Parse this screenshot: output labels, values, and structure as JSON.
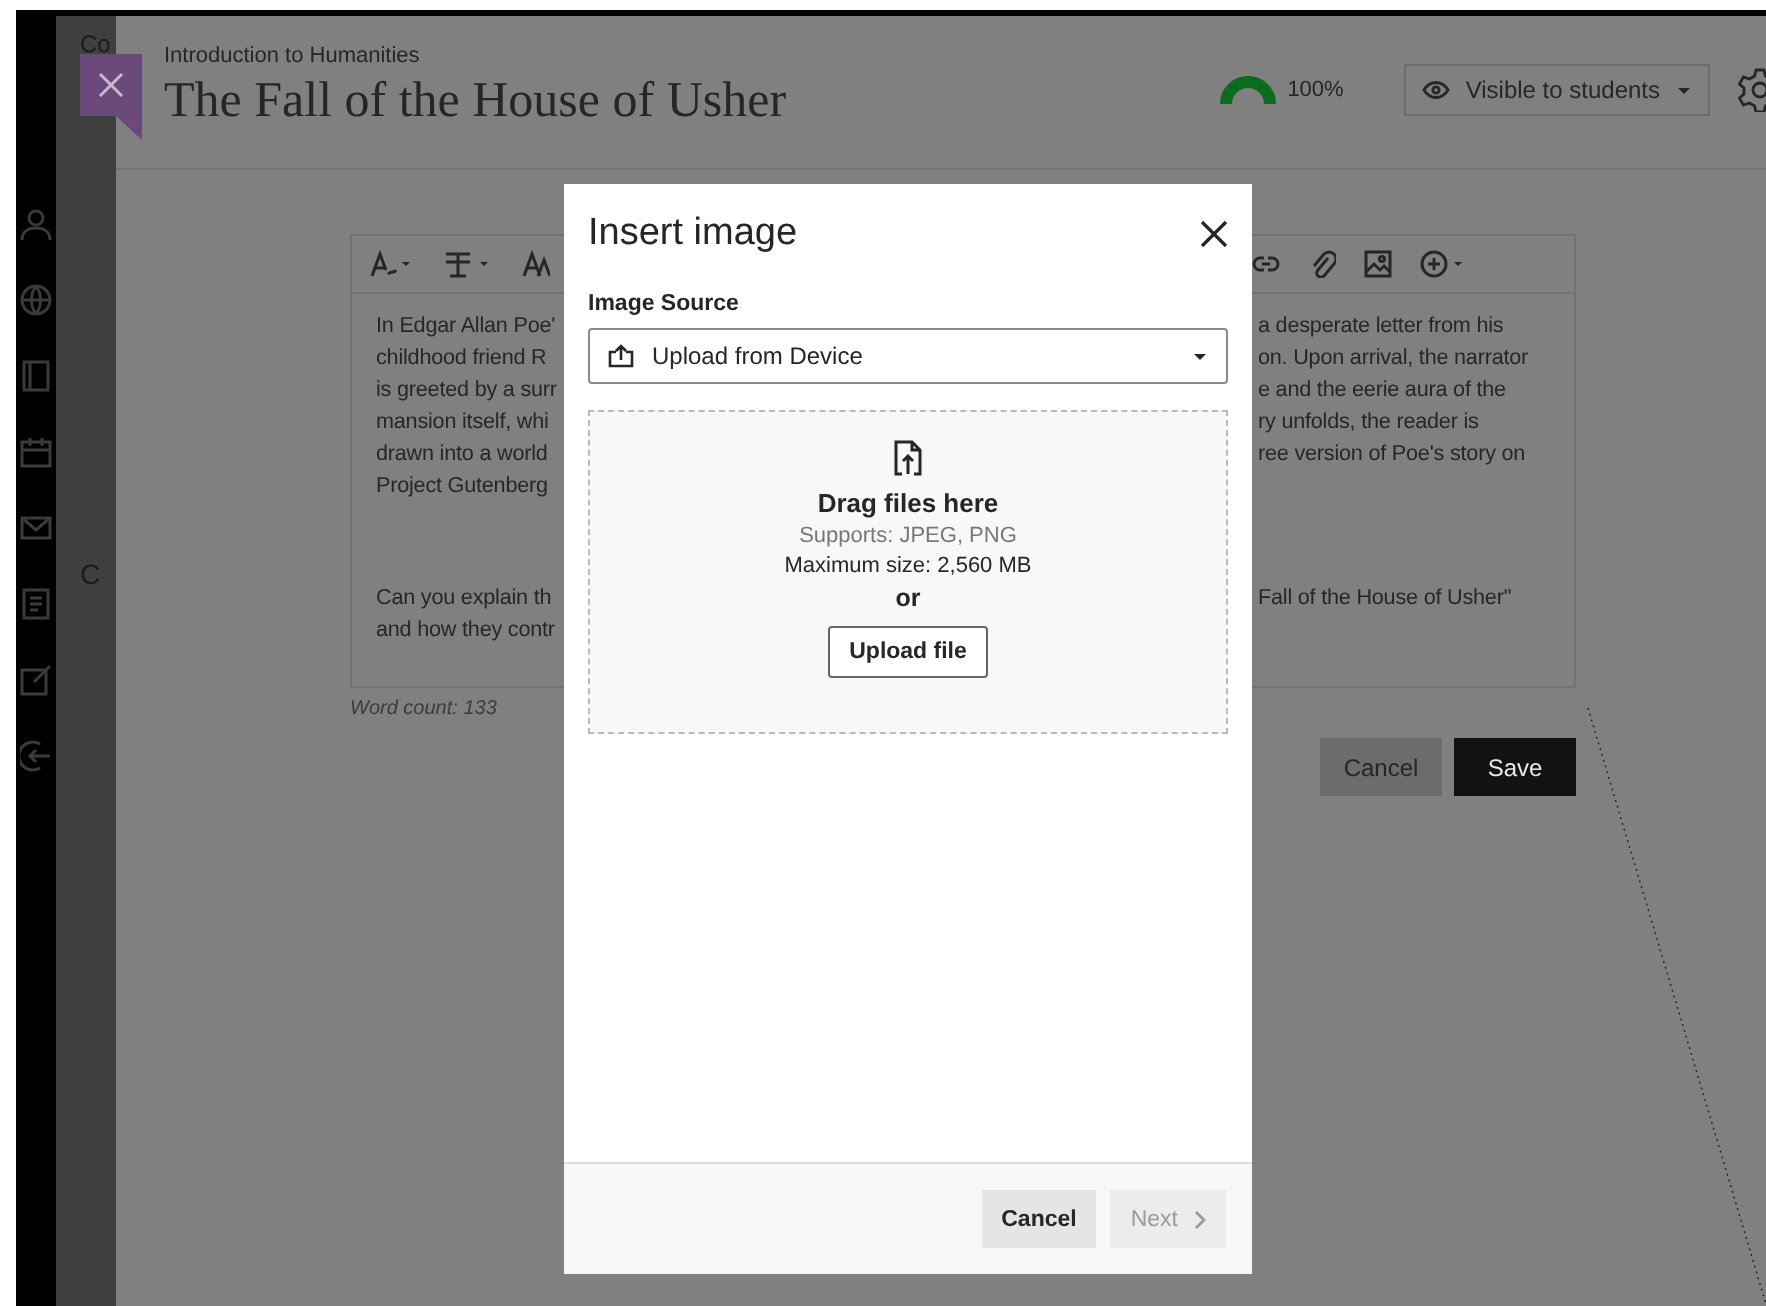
{
  "side_panel": {
    "texts": [
      "Co",
      "C"
    ]
  },
  "header": {
    "course": "Introduction to Humanities",
    "title": "The Fall of the House of Usher",
    "progress": {
      "reading": "100%"
    },
    "visibility": "Visible to students"
  },
  "editor": {
    "paragraphs": [
      {
        "lines": [
          {
            "left": "In Edgar Allan Poe'",
            "right": "a desperate letter from his"
          },
          {
            "left": "childhood friend R",
            "right": "on. Upon arrival, the narrator"
          },
          {
            "left": "is greeted by a surr",
            "right": "e and the eerie aura of the"
          },
          {
            "left": "mansion itself, whi",
            "right": "ry unfolds, the reader is"
          },
          {
            "left": "drawn into a world",
            "right": "ree version of Poe's story on"
          },
          {
            "left": "Project Gutenberg"
          }
        ]
      },
      {
        "lines": [
          {
            "left": "Can you explain th",
            "right": "Fall of the House of Usher\""
          },
          {
            "left": "and how they contr"
          }
        ]
      }
    ],
    "word_count": "Word count: 133"
  },
  "buttons": [
    {
      "label": "Cancel",
      "kind": "secondary"
    },
    {
      "label": "Save",
      "kind": "primary"
    }
  ],
  "dialog": {
    "title": "Insert image",
    "source_label": "Image Source",
    "source_value": "Upload from Device",
    "drop": {
      "heading": "Drag files here",
      "supports": "Supports: JPEG, PNG",
      "max_size": "Maximum size: 2,560 MB",
      "or": "or",
      "button": "Upload file"
    },
    "footer_buttons": [
      {
        "label": "Cancel",
        "disabled": false,
        "kind": "cancel"
      },
      {
        "label": "Next",
        "disabled": true,
        "kind": "next"
      }
    ]
  }
}
